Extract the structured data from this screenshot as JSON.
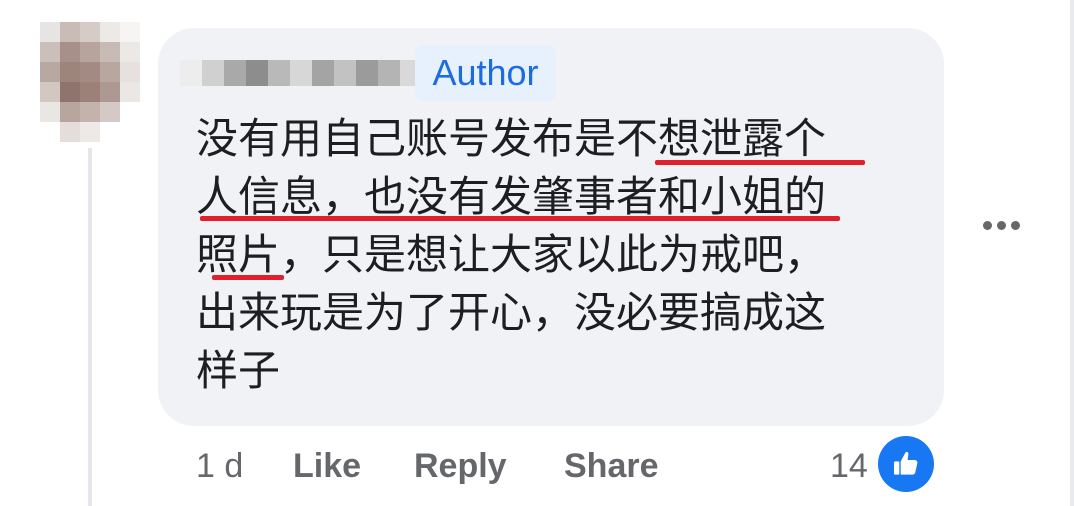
{
  "comment": {
    "author_badge": "Author",
    "lines": [
      "没有用自己账号发布是不想泄露个",
      "人信息，也没有发肇事者和小姐的",
      "照片，只是想让大家以此为戒吧，",
      "出来玩是为了开心，没必要搞成这",
      "样子"
    ]
  },
  "footer": {
    "time": "1 d",
    "like_label": "Like",
    "reply_label": "Reply",
    "share_label": "Share",
    "reaction_count": "14"
  },
  "icons": {
    "reaction": "thumbs-up-icon",
    "more": "more-horizontal-icon"
  },
  "colors": {
    "bubble": "#f0f2f5",
    "author_badge_bg": "#e7f0fd",
    "author_badge_text": "#1b6ce3",
    "underline": "#e0202a",
    "like_blue": "#1877f2",
    "meta_text": "#65676b",
    "body_text": "#1c1e21"
  }
}
